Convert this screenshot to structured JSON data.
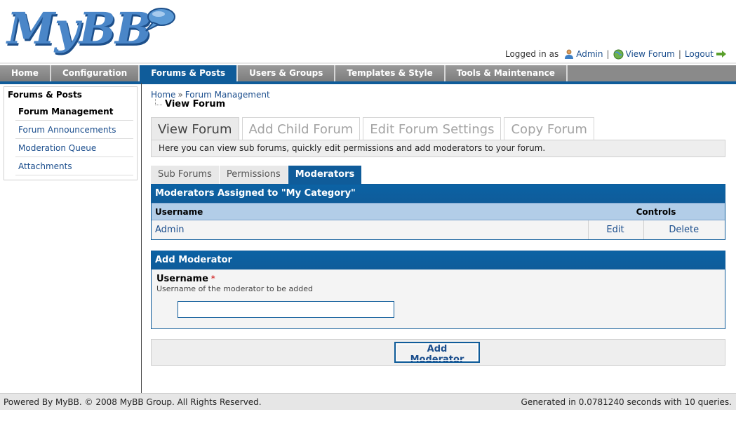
{
  "header": {
    "logo_text": "MyBB",
    "logged_in_label": "Logged in as",
    "user_name": "Admin",
    "view_forum_label": "View Forum",
    "logout_label": "Logout",
    "separator": "|"
  },
  "menu": {
    "items": [
      {
        "label": "Home"
      },
      {
        "label": "Configuration"
      },
      {
        "label": "Forums & Posts"
      },
      {
        "label": "Users & Groups"
      },
      {
        "label": "Templates & Style"
      },
      {
        "label": "Tools & Maintenance"
      }
    ],
    "active_index": 2
  },
  "sidebar": {
    "title": "Forums & Posts",
    "items": [
      {
        "label": "Forum Management"
      },
      {
        "label": "Forum Announcements"
      },
      {
        "label": "Moderation Queue"
      },
      {
        "label": "Attachments"
      }
    ]
  },
  "breadcrumb": {
    "home": "Home",
    "separator": "»",
    "current": "Forum Management"
  },
  "page_title": "View Forum",
  "tabs": {
    "main": [
      {
        "label": "View Forum"
      },
      {
        "label": "Add Child Forum"
      },
      {
        "label": "Edit Forum Settings"
      },
      {
        "label": "Copy Forum"
      }
    ],
    "description": "Here you can view sub forums, quickly edit permissions and add moderators to your forum.",
    "sub": [
      {
        "label": "Sub Forums"
      },
      {
        "label": "Permissions"
      },
      {
        "label": "Moderators"
      }
    ]
  },
  "moderators": {
    "heading": "Moderators Assigned to \"My Category\"",
    "col_username": "Username",
    "col_controls": "Controls",
    "rows": [
      {
        "username": "Admin",
        "edit": "Edit",
        "delete": "Delete"
      }
    ]
  },
  "add_moderator": {
    "heading": "Add Moderator",
    "field_label": "Username",
    "required_mark": "*",
    "field_description": "Username of the moderator to be added",
    "input_value": "",
    "submit_label": "Add Moderator"
  },
  "footer": {
    "left": "Powered By MyBB. © 2008 MyBB Group. All Rights Reserved.",
    "right": "Generated in 0.0781240 seconds with 10 queries."
  },
  "colors": {
    "accent": "#0f5c9a",
    "menu_gray": "#8a8a8a",
    "link": "#1b4e8d",
    "table_header": "#b2cde8"
  }
}
